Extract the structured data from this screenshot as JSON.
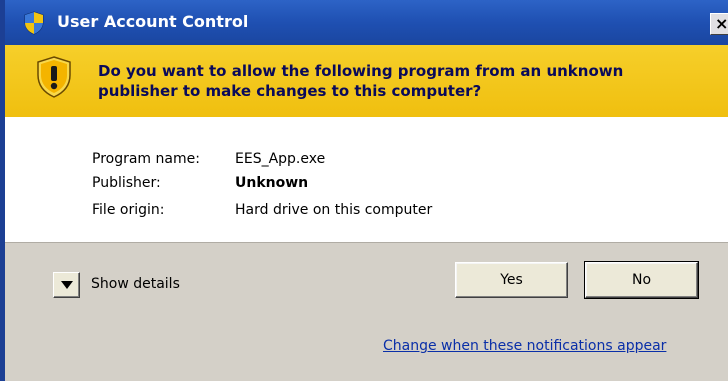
{
  "window": {
    "title": "User Account Control",
    "close_glyph": "×",
    "title_icon": "uac-shield-icon"
  },
  "banner": {
    "icon": "warning-shield-icon",
    "message": "Do you want to allow the following program from an unknown publisher to make changes to this computer?"
  },
  "program_info": [
    {
      "label": "Program name:",
      "value": "EES_App.exe",
      "bold": false
    },
    {
      "label": "Publisher:",
      "value": "Unknown",
      "bold": true
    },
    {
      "label": "File origin:",
      "value": "Hard drive on this computer",
      "bold": false
    }
  ],
  "footer": {
    "show_details_label": "Show details",
    "yes_label": "Yes",
    "no_label": "No",
    "change_link": "Change when these notifications appear"
  },
  "colors": {
    "titlebar": "#1f50b2",
    "banner": "#f2c411",
    "banner_text": "#0a0a5a",
    "footer": "#d4d0c8",
    "link": "#0a2fa8"
  }
}
